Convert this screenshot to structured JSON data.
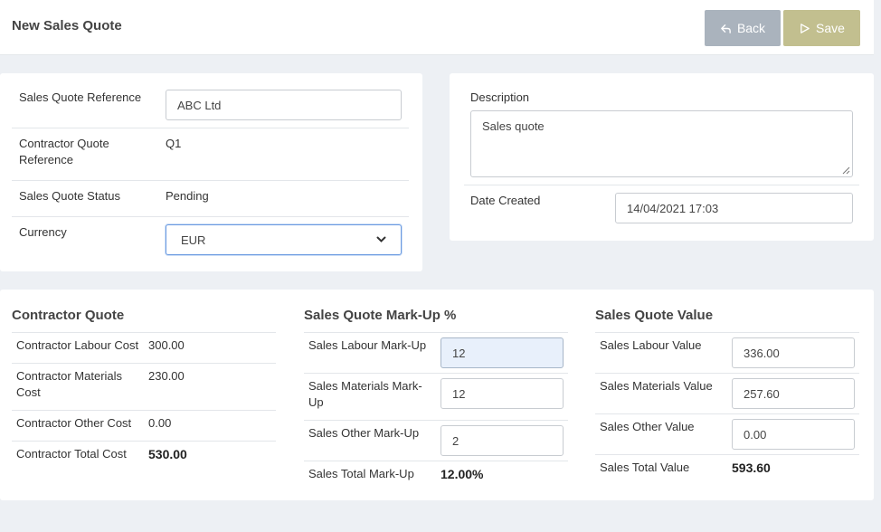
{
  "header": {
    "title": "New Sales Quote",
    "back_label": "Back",
    "save_label": "Save"
  },
  "quote_info": {
    "reference_label": "Sales Quote Reference",
    "reference_value": "ABC Ltd",
    "contractor_ref_label_line1": "Contractor Quote",
    "contractor_ref_label_line2": "Reference",
    "contractor_ref_value": "Q1",
    "status_label": "Sales Quote Status",
    "status_value": "Pending",
    "currency_label": "Currency",
    "currency_value": "EUR"
  },
  "description_panel": {
    "description_label": "Description",
    "description_value": "Sales quote",
    "date_label": "Date Created",
    "date_value": "14/04/2021 17:03"
  },
  "contractor_quote": {
    "title": "Contractor Quote",
    "labour_label": "Contractor Labour Cost",
    "labour_value": "300.00",
    "materials_label_line1": "Contractor Materials",
    "materials_label_line2": "Cost",
    "materials_value": "230.00",
    "other_label": "Contractor Other Cost",
    "other_value": "0.00",
    "total_label": "Contractor Total Cost",
    "total_value": "530.00"
  },
  "markup": {
    "title": "Sales Quote Mark-Up %",
    "labour_label": "Sales Labour Mark-Up",
    "labour_value": "12",
    "materials_label_line1": "Sales Materials Mark-",
    "materials_label_line2": "Up",
    "materials_value": "12",
    "other_label": "Sales Other Mark-Up",
    "other_value": "2",
    "total_label": "Sales Total Mark-Up",
    "total_value": "12.00%"
  },
  "sales_value": {
    "title": "Sales Quote Value",
    "labour_label": "Sales Labour Value",
    "labour_value": "336.00",
    "materials_label": "Sales Materials Value",
    "materials_value": "257.60",
    "other_label": "Sales Other Value",
    "other_value": "0.00",
    "total_label": "Sales Total Value",
    "total_value": "593.60"
  }
}
